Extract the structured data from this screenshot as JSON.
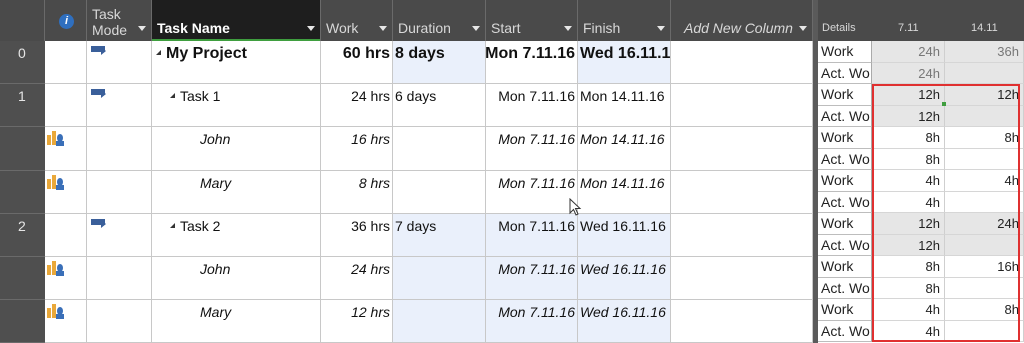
{
  "headers": {
    "info_icon": "i",
    "task_mode": "Task Mode",
    "task_name": "Task Name",
    "work": "Work",
    "duration": "Duration",
    "start": "Start",
    "finish": "Finish",
    "add_new_column": "Add New Column"
  },
  "rows": [
    {
      "id": "0",
      "name": "My Project",
      "work": "60 hrs",
      "duration": "8 days",
      "start": "Mon 7.11.16",
      "finish": "Wed 16.11.16"
    },
    {
      "id": "1",
      "name": "Task 1",
      "work": "24 hrs",
      "duration": "6 days",
      "start": "Mon 7.11.16",
      "finish": "Mon 14.11.16"
    },
    {
      "id": "",
      "name": "John",
      "work": "16 hrs",
      "duration": "",
      "start": "Mon 7.11.16",
      "finish": "Mon 14.11.16"
    },
    {
      "id": "",
      "name": "Mary",
      "work": "8 hrs",
      "duration": "",
      "start": "Mon 7.11.16",
      "finish": "Mon 14.11.16"
    },
    {
      "id": "2",
      "name": "Task 2",
      "work": "36 hrs",
      "duration": "7 days",
      "start": "Mon 7.11.16",
      "finish": "Wed 16.11.16"
    },
    {
      "id": "",
      "name": "John",
      "work": "24 hrs",
      "duration": "",
      "start": "Mon 7.11.16",
      "finish": "Wed 16.11.16"
    },
    {
      "id": "",
      "name": "Mary",
      "work": "12 hrs",
      "duration": "",
      "start": "Mon 7.11.16",
      "finish": "Wed 16.11.16"
    }
  ],
  "timephased": {
    "details_label": "Details",
    "col1": "7.11",
    "col2": "14.11",
    "work_label": "Work",
    "actwork_label": "Act. Wo",
    "values": [
      [
        "24h",
        "36h"
      ],
      [
        "24h",
        ""
      ],
      [
        "12h",
        "12h"
      ],
      [
        "12h",
        ""
      ],
      [
        "8h",
        "8h"
      ],
      [
        "8h",
        ""
      ],
      [
        "4h",
        "4h"
      ],
      [
        "4h",
        ""
      ],
      [
        "12h",
        "24h"
      ],
      [
        "12h",
        ""
      ],
      [
        "8h",
        "16h"
      ],
      [
        "8h",
        ""
      ],
      [
        "4h",
        "8h"
      ],
      [
        "4h",
        ""
      ]
    ]
  },
  "colors": {
    "header_bg": "#4a4a4a",
    "selected_header": "#1e1e1e",
    "highlight": "#eaf0fb",
    "outline": "#e03030"
  }
}
